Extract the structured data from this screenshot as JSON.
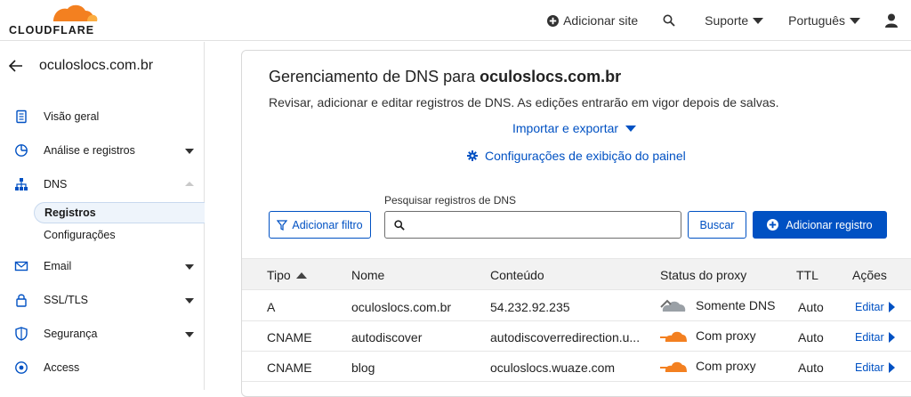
{
  "brand": {
    "name": "CLOUDFLARE",
    "accent": "#f38020"
  },
  "topnav": {
    "add_site": "Adicionar site",
    "support": "Suporte",
    "language": "Português"
  },
  "sidebar": {
    "zone": "oculoslocs.com.br",
    "items": [
      {
        "label": "Visão geral",
        "icon": "document-icon"
      },
      {
        "label": "Análise e registros",
        "icon": "chart-pie-icon"
      },
      {
        "label": "DNS",
        "icon": "network-icon"
      },
      {
        "label": "Email",
        "icon": "email-icon"
      },
      {
        "label": "SSL/TLS",
        "icon": "lock-icon"
      },
      {
        "label": "Segurança",
        "icon": "shield-icon"
      },
      {
        "label": "Access",
        "icon": "access-icon"
      }
    ],
    "dns_sub": [
      "Registros",
      "Configurações"
    ]
  },
  "main": {
    "title_prefix": "Gerenciamento de DNS para ",
    "title_domain": "oculoslocs.com.br",
    "description": "Revisar, adicionar e editar registros de DNS. As edições entrarão em vigor depois de salvas.",
    "import_export": "Importar e exportar",
    "panel_settings": "Configurações de exibição do painel",
    "search_label": "Pesquisar registros de DNS",
    "search_value": "",
    "filter_btn": "Adicionar filtro",
    "search_btn": "Buscar",
    "add_btn": "Adicionar registro"
  },
  "table": {
    "headers": [
      "Tipo",
      "Nome",
      "Conteúdo",
      "Status do proxy",
      "TTL",
      "Ações"
    ],
    "rows": [
      {
        "type": "A",
        "name": "oculoslocs.com.br",
        "content": "54.232.92.235",
        "proxy": "Somente DNS",
        "proxied": false,
        "ttl": "Auto",
        "action": "Editar"
      },
      {
        "type": "CNAME",
        "name": "autodiscover",
        "content": "autodiscoverredirection.u...",
        "proxy": "Com proxy",
        "proxied": true,
        "ttl": "Auto",
        "action": "Editar"
      },
      {
        "type": "CNAME",
        "name": "blog",
        "content": "oculoslocs.wuaze.com",
        "proxy": "Com proxy",
        "proxied": true,
        "ttl": "Auto",
        "action": "Editar"
      }
    ]
  }
}
